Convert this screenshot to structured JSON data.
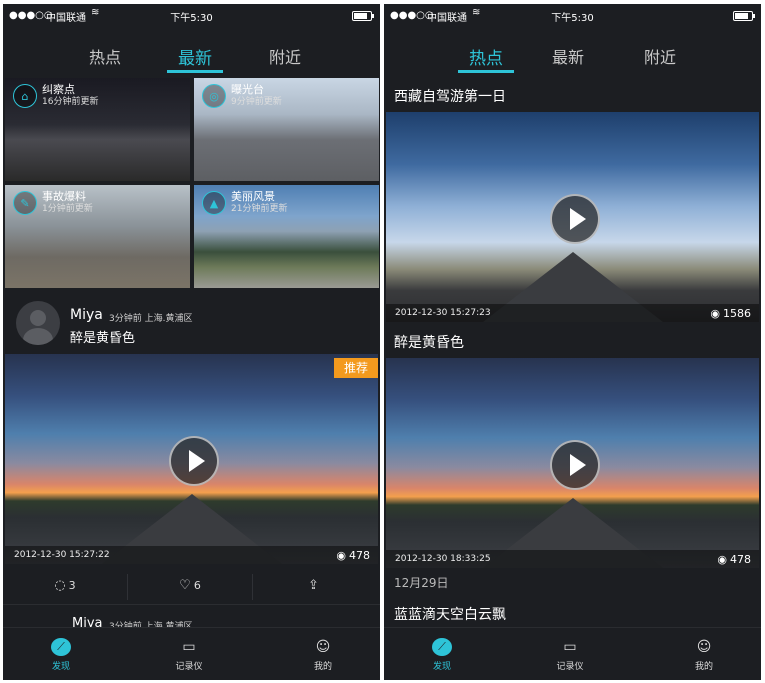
{
  "status": {
    "carrier": "中国联通",
    "signal": "●●●○○",
    "time": "下午5:30"
  },
  "tabs": [
    "热点",
    "最新",
    "附近"
  ],
  "left": {
    "active_tab": 1,
    "categories": [
      {
        "name": "纠察点",
        "updated": "16分钟前更新",
        "icon": "police-icon"
      },
      {
        "name": "曝光台",
        "updated": "9分钟前更新",
        "icon": "camera-icon"
      },
      {
        "name": "事故爆料",
        "updated": "1分钟前更新",
        "icon": "wrench-icon"
      },
      {
        "name": "美丽风景",
        "updated": "21分钟前更新",
        "icon": "landscape-icon"
      }
    ],
    "post": {
      "user": "Miya",
      "meta": "3分钟前  上海.黄浦区",
      "caption": "醉是黄昏色",
      "badge": "推荐",
      "date": "2012-12-30   15:27:22",
      "views": "478",
      "comments": "3",
      "likes": "6"
    },
    "next_post": {
      "user": "Miya",
      "meta": "3分钟前  上海.黄浦区"
    }
  },
  "right": {
    "active_tab": 0,
    "items": [
      {
        "title": "西藏自驾游第一日",
        "date": "2012-12-30   15:27:23",
        "views": "1586"
      },
      {
        "title": "醉是黄昏色",
        "date": "2012-12-30   18:33:25",
        "views": "478"
      }
    ],
    "section_date": "12月29日",
    "next_title": "蓝蓝滴天空白云飘"
  },
  "tabbar": [
    "发现",
    "记录仪",
    "我的"
  ],
  "colors": {
    "accent": "#2ec4d8",
    "badge": "#f39a1e",
    "background": "#1c1e22"
  }
}
